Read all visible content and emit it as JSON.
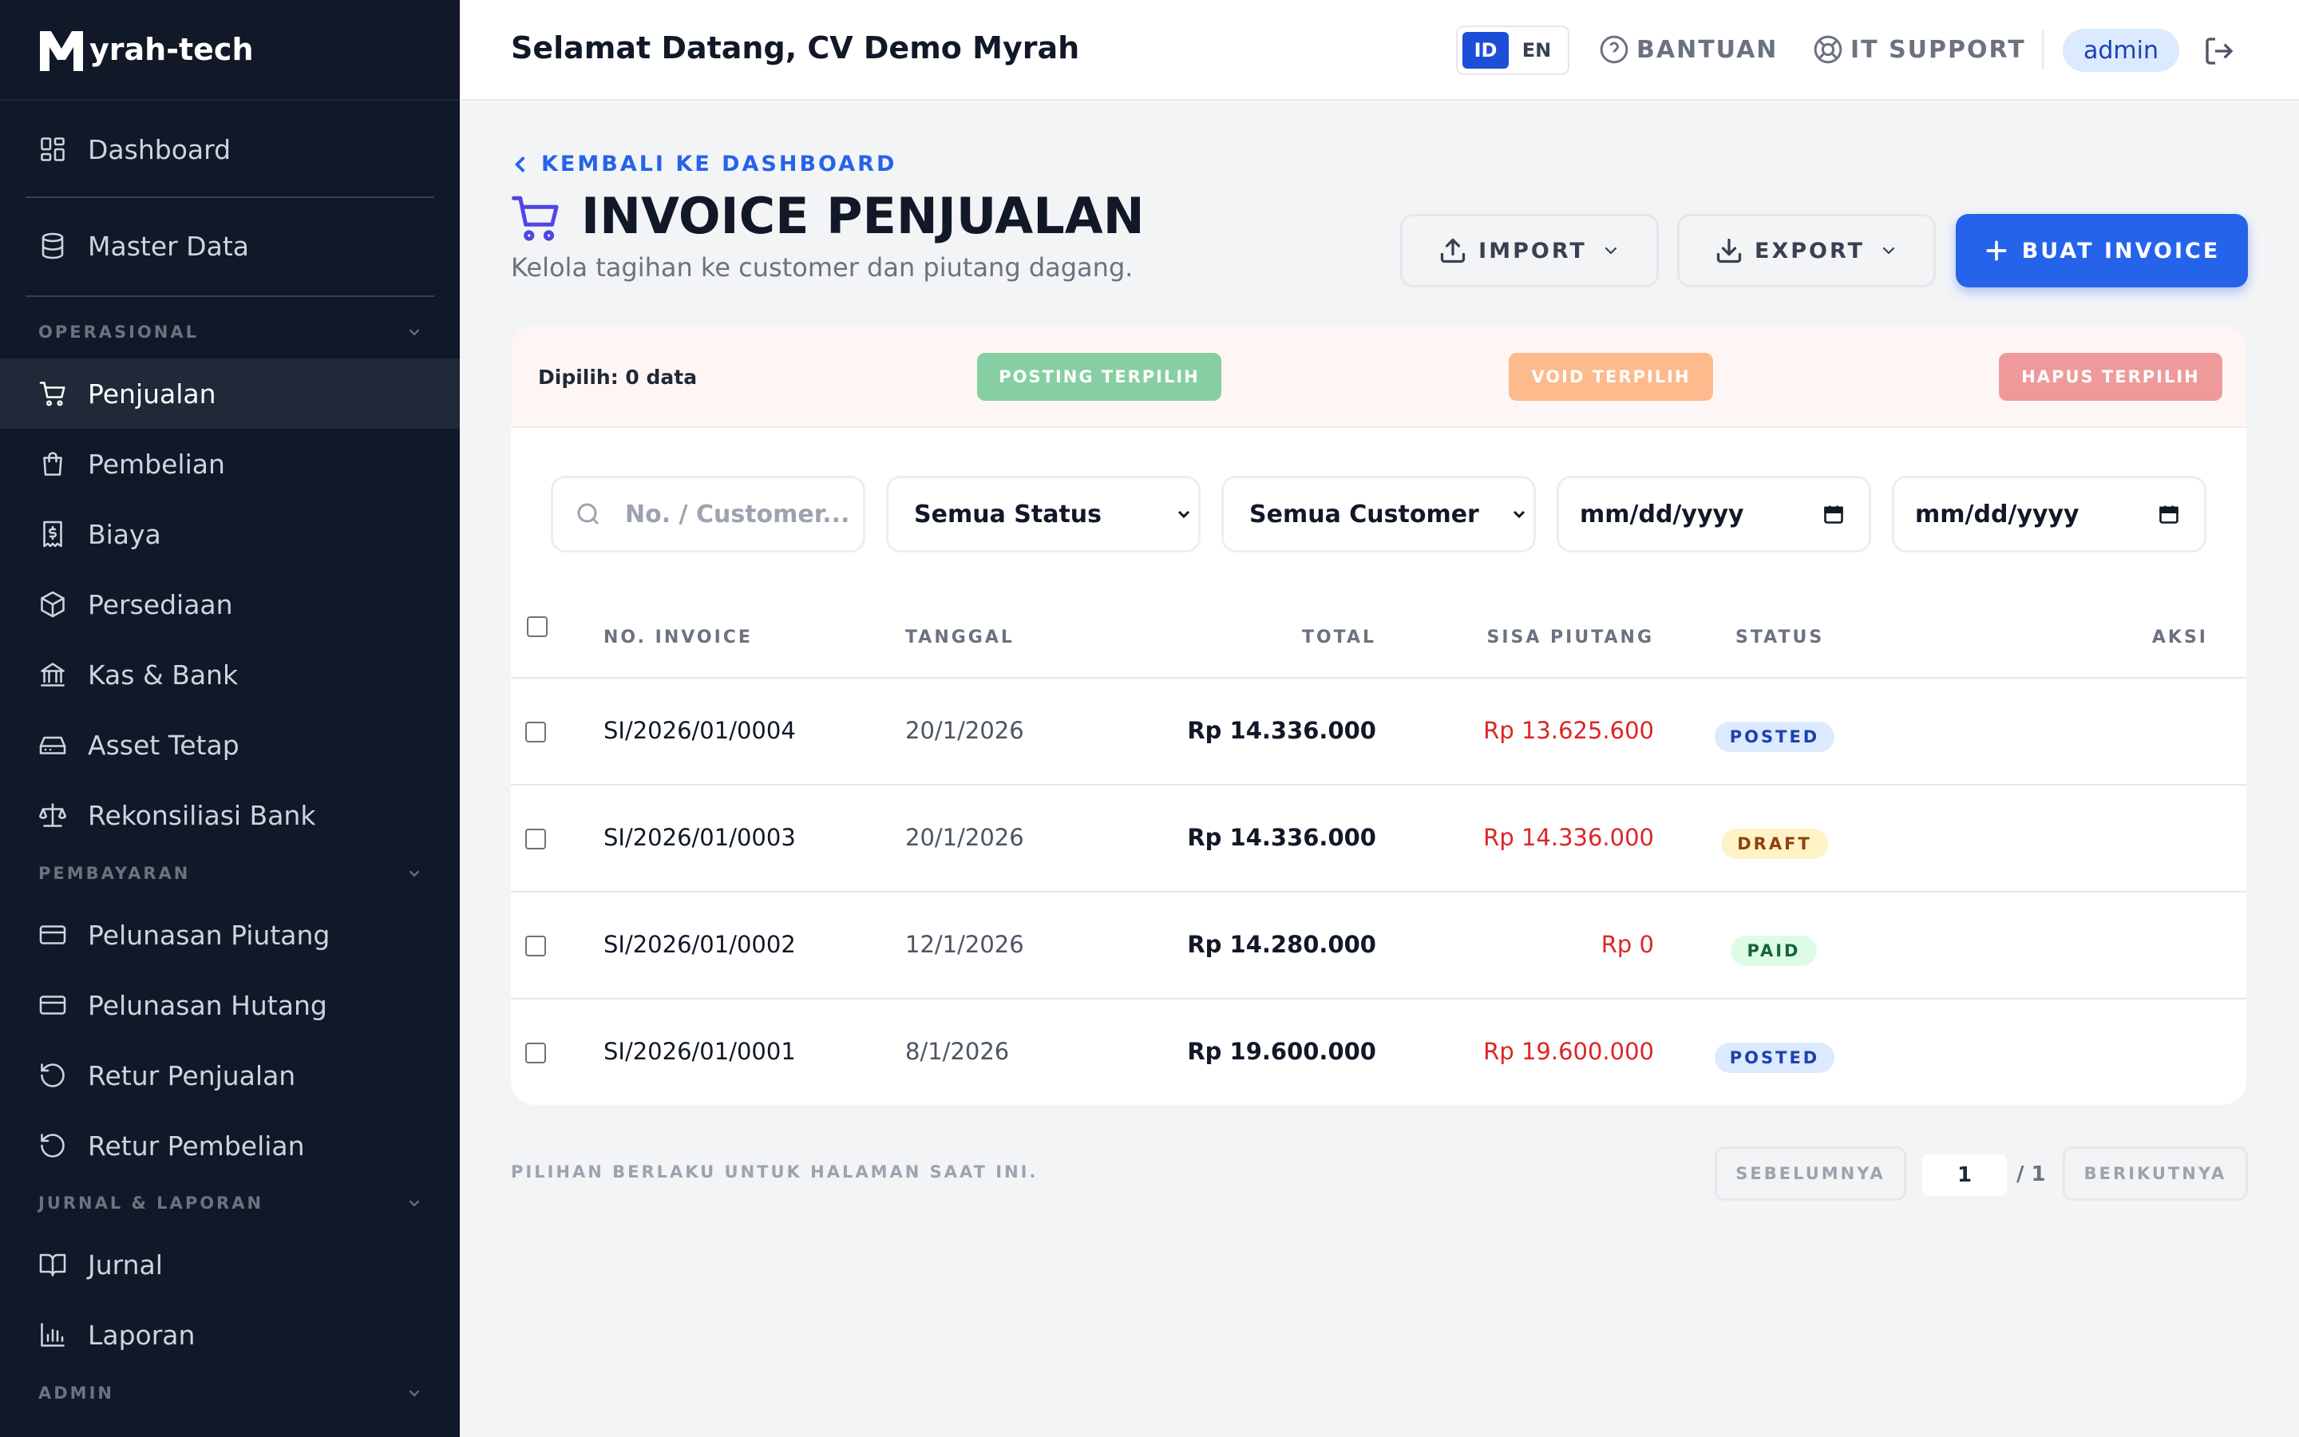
{
  "brand": {
    "name": "yrah-tech"
  },
  "sidebar": {
    "items": [
      {
        "label": "Dashboard",
        "icon": "dashboard-icon"
      },
      {
        "label": "Master Data",
        "icon": "database-icon"
      },
      {
        "label": "Penjualan",
        "icon": "cart-icon",
        "active": true
      },
      {
        "label": "Pembelian",
        "icon": "bag-icon"
      },
      {
        "label": "Biaya",
        "icon": "receipt-icon"
      },
      {
        "label": "Persediaan",
        "icon": "box-icon"
      },
      {
        "label": "Kas & Bank",
        "icon": "bank-icon"
      },
      {
        "label": "Asset Tetap",
        "icon": "hdd-icon"
      },
      {
        "label": "Rekonsiliasi Bank",
        "icon": "scale-icon"
      },
      {
        "label": "Pelunasan Piutang",
        "icon": "card-icon"
      },
      {
        "label": "Pelunasan Hutang",
        "icon": "card-icon"
      },
      {
        "label": "Retur Penjualan",
        "icon": "return-icon"
      },
      {
        "label": "Retur Pembelian",
        "icon": "return-icon"
      },
      {
        "label": "Jurnal",
        "icon": "book-icon"
      },
      {
        "label": "Laporan",
        "icon": "chart-icon"
      }
    ],
    "sections": [
      "OPERASIONAL",
      "PEMBAYARAN",
      "JURNAL & LAPORAN",
      "ADMIN"
    ]
  },
  "header": {
    "welcome": "Selamat Datang, CV Demo Myrah",
    "lang_active": "ID",
    "lang_other": "EN",
    "help": "BANTUAN",
    "support": "IT SUPPORT",
    "user": "admin"
  },
  "page": {
    "back": "KEMBALI KE DASHBOARD",
    "title": "INVOICE PENJUALAN",
    "subtitle": "Kelola tagihan ke customer dan piutang dagang.",
    "import": "IMPORT",
    "export": "EXPORT",
    "create": "BUAT INVOICE"
  },
  "bulk": {
    "selected": "Dipilih: 0 data",
    "post": "POSTING TERPILIH",
    "void": "VOID TERPILIH",
    "delete": "HAPUS TERPILIH"
  },
  "filters": {
    "search_placeholder": "No. / Customer...",
    "status": "Semua Status",
    "customer": "Semua Customer",
    "date_from": "mm/dd/yyyy",
    "date_to": "mm/dd/yyyy"
  },
  "table": {
    "columns": [
      "NO. INVOICE",
      "TANGGAL",
      "TOTAL",
      "SISA PIUTANG",
      "STATUS",
      "AKSI"
    ],
    "rows": [
      {
        "no": "SI/2026/01/0004",
        "date": "20/1/2026",
        "total": "Rp 14.336.000",
        "remaining": "Rp 13.625.600",
        "status": "POSTED"
      },
      {
        "no": "SI/2026/01/0003",
        "date": "20/1/2026",
        "total": "Rp 14.336.000",
        "remaining": "Rp 14.336.000",
        "status": "DRAFT"
      },
      {
        "no": "SI/2026/01/0002",
        "date": "12/1/2026",
        "total": "Rp 14.280.000",
        "remaining": "Rp 0",
        "status": "PAID"
      },
      {
        "no": "SI/2026/01/0001",
        "date": "8/1/2026",
        "total": "Rp 19.600.000",
        "remaining": "Rp 19.600.000",
        "status": "POSTED"
      }
    ]
  },
  "footer": {
    "note": "PILIHAN BERLAKU UNTUK HALAMAN SAAT INI.",
    "prev": "SEBELUMNYA",
    "page": "1",
    "total": "/ 1",
    "next": "BERIKUTNYA"
  },
  "colors": {
    "primary": "#2563eb",
    "sidebar": "#111827",
    "danger_text": "#dc2626"
  }
}
